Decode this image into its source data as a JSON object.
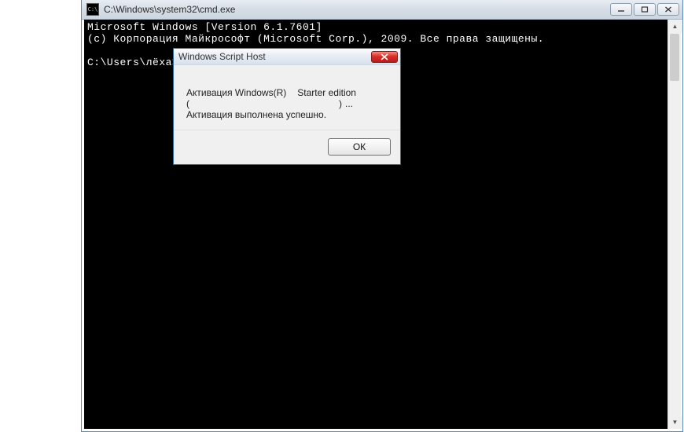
{
  "window": {
    "icon_label": "C:\\",
    "title": "C:\\Windows\\system32\\cmd.exe"
  },
  "terminal": {
    "line1": "Microsoft Windows [Version 6.1.7601]",
    "line2": "(c) Корпорация Майкрософт (Microsoft Corp.), 2009. Все права защищены.",
    "blank": "",
    "prompt": "C:\\Users\\лёха>"
  },
  "dialog": {
    "title": "Windows Script Host",
    "msg_line1_a": "Активация Windows(R)",
    "msg_line1_b": "Starter edition",
    "msg_line2_open": "(",
    "msg_line2_close": ")",
    "msg_line2_dots": "...",
    "msg_line3": "Активация выполнена успешно.",
    "ok_label": "ОК"
  }
}
